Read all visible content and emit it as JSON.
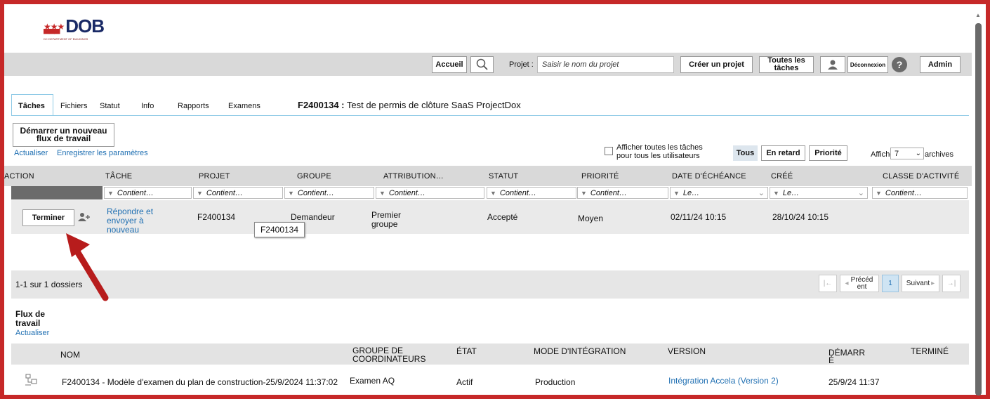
{
  "logo": {
    "text": "DOB",
    "tagline": "DC DEPARTMENT OF BUILDINGS"
  },
  "topbar": {
    "home": "Accueil",
    "project_label": "Projet :",
    "project_placeholder": "Saisir le nom du projet",
    "create_project": "Créer un projet",
    "all_tasks": "Toutes les tâches",
    "logout": "Déconnexion",
    "admin": "Admin"
  },
  "tabs": [
    "Tâches",
    "Fichiers",
    "Statut",
    "Info",
    "Rapports",
    "Examens"
  ],
  "project_title": {
    "id": "F2400134 :",
    "name": "Test de permis de clôture SaaS ProjectDox"
  },
  "start_workflow": "Démarrer un nouveau flux de travail",
  "actions": {
    "refresh": "Actualiser",
    "save_settings": "Enregistrer les paramètres"
  },
  "filters": {
    "show_all": "Afficher toutes les tâches pour tous les utilisateurs",
    "all": "Tous",
    "late": "En retard",
    "priority": "Priorité",
    "show_label": "Afficher",
    "show_value": "7",
    "archives": "archives"
  },
  "task_table": {
    "headers": [
      "ACTION",
      "TÂCHE",
      "PROJET",
      "GROUPE",
      "ATTRIBUTION…",
      "STATUT",
      "PRIORITÉ",
      "DATE D'ÉCHÉANCE",
      "CRÉÉ",
      "CLASSE D'ACTIVITÉ"
    ],
    "filter_contains": "Contient…",
    "filter_le": "Le…",
    "row": {
      "action": "Terminer",
      "task": "Répondre et envoyer à nouveau",
      "project": "F2400134",
      "group": "Demandeur",
      "assignment": "Premier groupe",
      "status": "Accepté",
      "priority": "Moyen",
      "due": "02/11/24 10:15",
      "created": "28/10/24 10:15"
    },
    "tooltip": "F2400134"
  },
  "pager": {
    "summary": "1-1 sur 1 dossiers",
    "prev": "Précéd ent",
    "page": "1",
    "next": "Suivant"
  },
  "workflow": {
    "title": "Flux de travail",
    "refresh": "Actualiser",
    "headers": {
      "name": "NOM",
      "coord": "GROUPE DE COORDINATEURS",
      "state": "ÉTAT",
      "mode": "MODE D'INTÉGRATION",
      "version": "VERSION",
      "start": "DÉMARR É",
      "end": "TERMINÉ"
    },
    "row": {
      "name": "F2400134 - Modèle d'examen du plan de construction-25/9/2024 11:37:02",
      "coord": "Examen AQ",
      "state": "Actif",
      "mode": "Production",
      "version": "Intégration Accela (Version 2)",
      "start": "25/9/24 11:37"
    }
  },
  "colors": {
    "frame": "#c62828",
    "link": "#1f6fb2",
    "bar": "#d9d9d9",
    "accent_tab": "#8ecae6",
    "arrow": "#b71c1c"
  }
}
